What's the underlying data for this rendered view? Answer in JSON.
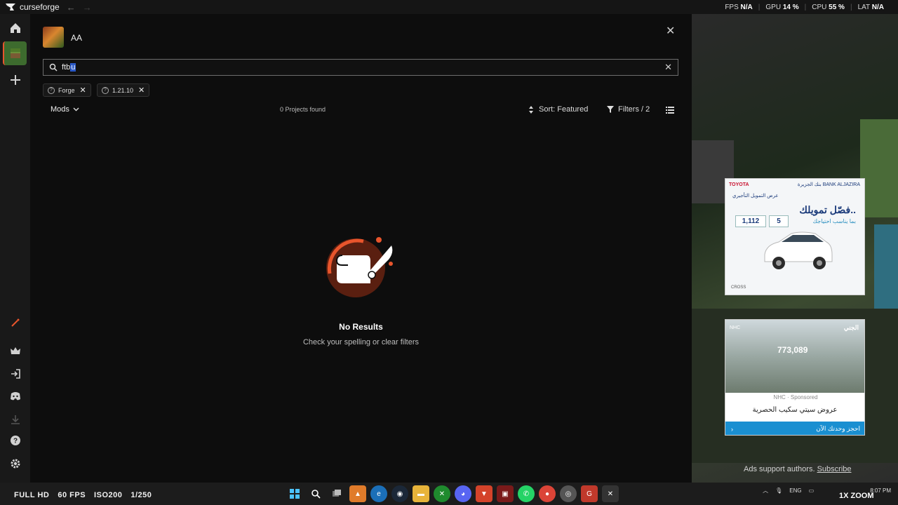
{
  "titlebar": {
    "app_name": "curseforge",
    "perf": {
      "fps_label": "FPS",
      "fps_value": "N/A",
      "gpu_label": "GPU",
      "gpu_value": "14 %",
      "cpu_label": "CPU",
      "cpu_value": "55 %",
      "lat_label": "LAT",
      "lat_value": "N/A"
    }
  },
  "sidebar": {
    "items": [
      {
        "name": "home-icon"
      },
      {
        "name": "minecraft-icon"
      },
      {
        "name": "add-icon"
      },
      {
        "name": "wand-icon"
      },
      {
        "name": "crown-icon"
      },
      {
        "name": "login-icon"
      },
      {
        "name": "discord-icon"
      },
      {
        "name": "download-icon"
      },
      {
        "name": "help-icon"
      },
      {
        "name": "settings-icon"
      }
    ]
  },
  "instance": {
    "name": "AA"
  },
  "search": {
    "value_before": "ftb",
    "value_selected": "u"
  },
  "chips": [
    {
      "label": "Forge"
    },
    {
      "label": "1.21.10"
    }
  ],
  "toolbar": {
    "category": "Mods",
    "results_count": "0 Projects found",
    "sort_label": "Sort: Featured",
    "filters_label": "Filters / 2"
  },
  "empty_state": {
    "title": "No Results",
    "subtitle": "Check your spelling or clear filters"
  },
  "ads": {
    "ad1": {
      "brand": "TOYOTA",
      "bank": "بنك الجزيرة BANK ALJAZIRA",
      "offer": "عرض التمويل التأجيري",
      "headline": "فصّل تمويلك..",
      "sub": "بما يناسب احتياجك",
      "price": "1,112",
      "years": "5",
      "model": "CROSS"
    },
    "ad2": {
      "logo": "NHC",
      "aljeni": "الجني",
      "price": "773,089",
      "sponsored": "NHC · Sponsored",
      "tagline": "عروض سيتي سكيب الحصرية",
      "cta": "احجز وحدتك الآن"
    },
    "support_text": "Ads support authors.",
    "support_link": "Subscribe"
  },
  "taskbar": {
    "overlay": [
      "FULL HD",
      "60 FPS",
      "ISO200",
      "1/250"
    ],
    "lang": "ENG",
    "time": "8:07 PM",
    "date": "",
    "zoom_watermark": "1X ZOOM"
  },
  "colors": {
    "accent": "#e8552c",
    "sidebar_bg": "#191919",
    "main_bg": "#0d0d0d",
    "search_border": "#6d6d6d"
  }
}
